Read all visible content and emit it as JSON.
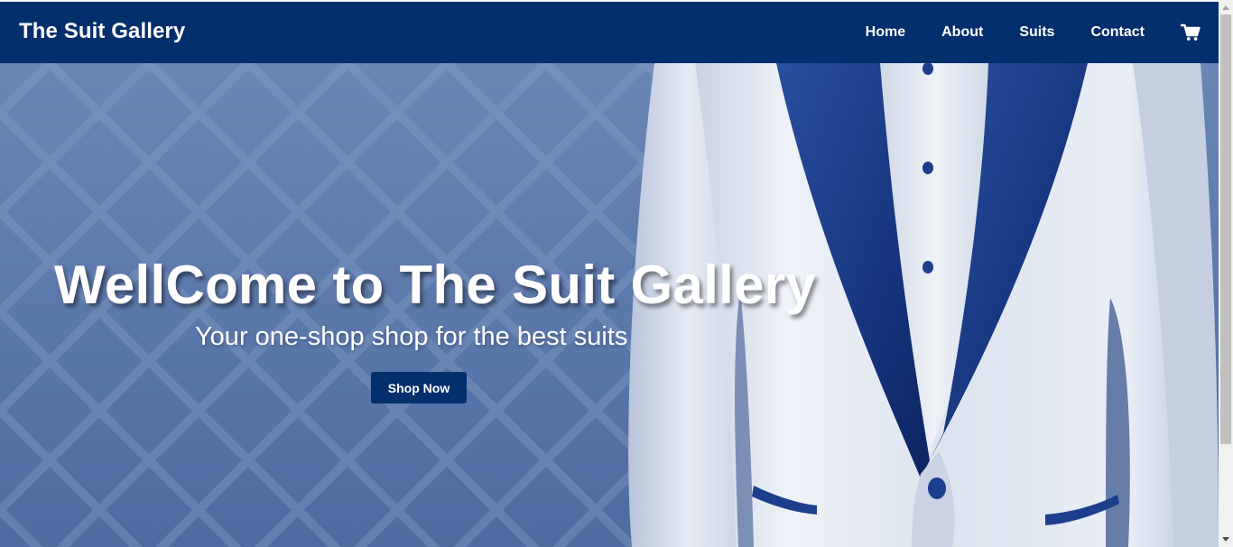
{
  "navbar": {
    "brand": "The Suit Gallery",
    "links": [
      "Home",
      "About",
      "Suits",
      "Contact"
    ],
    "cart_icon": "shopping-cart-icon",
    "background_color": "#032f6d"
  },
  "hero": {
    "title": "WellCome to The Suit Gallery",
    "subtitle": "Your one-shop shop for the best suits",
    "button_label": "Shop Now",
    "image": "white suit jacket with navy lapels"
  },
  "colors": {
    "brand_navy": "#032f6d",
    "hero_blue": "#5f7db0",
    "text": "#ffffff"
  }
}
